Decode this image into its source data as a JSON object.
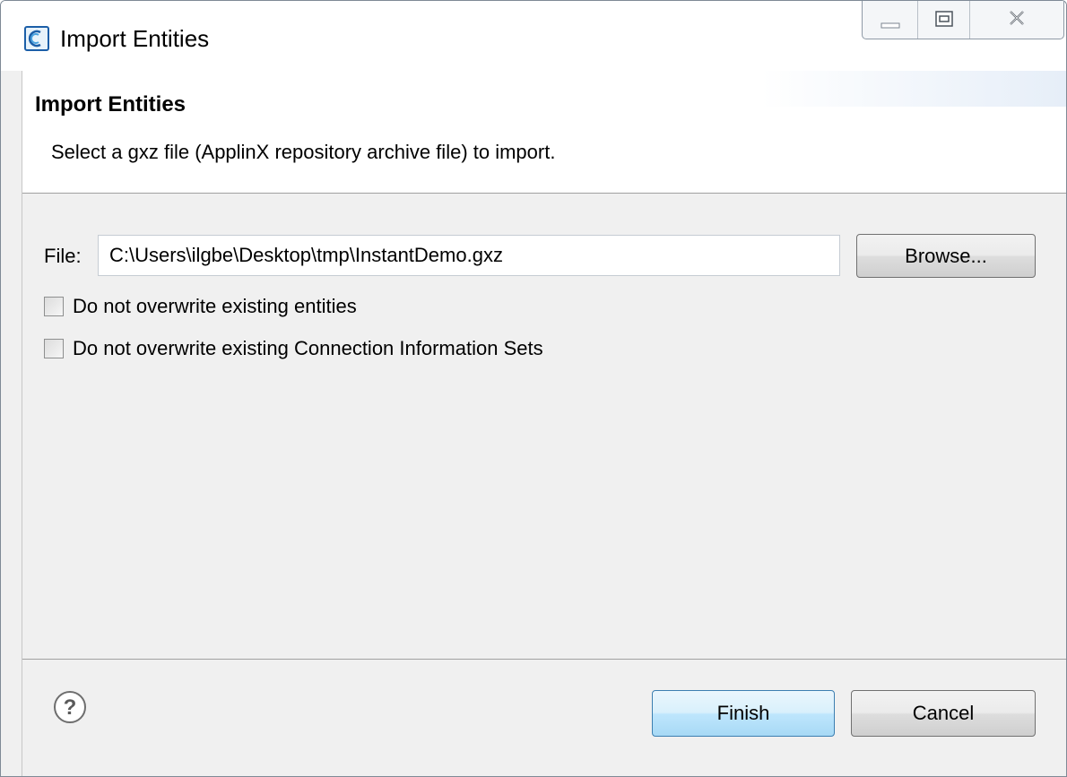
{
  "window": {
    "title": "Import Entities",
    "controls": [
      "minimize",
      "restore",
      "close"
    ]
  },
  "banner": {
    "title": "Import Entities",
    "description": "Select a gxz file (ApplinX repository archive file) to import."
  },
  "form": {
    "file_label": "File:",
    "file_value": "C:\\Users\\ilgbe\\Desktop\\tmp\\InstantDemo.gxz",
    "browse_label": "Browse...",
    "checkboxes": [
      {
        "label": "Do not overwrite existing entities",
        "checked": false
      },
      {
        "label": "Do not overwrite existing Connection Information Sets",
        "checked": false
      }
    ]
  },
  "footer": {
    "help_icon": "help-icon",
    "finish_label": "Finish",
    "cancel_label": "Cancel"
  },
  "colors": {
    "default_button_border": "#3c7fb1",
    "app_icon": "#1c5fa8"
  }
}
